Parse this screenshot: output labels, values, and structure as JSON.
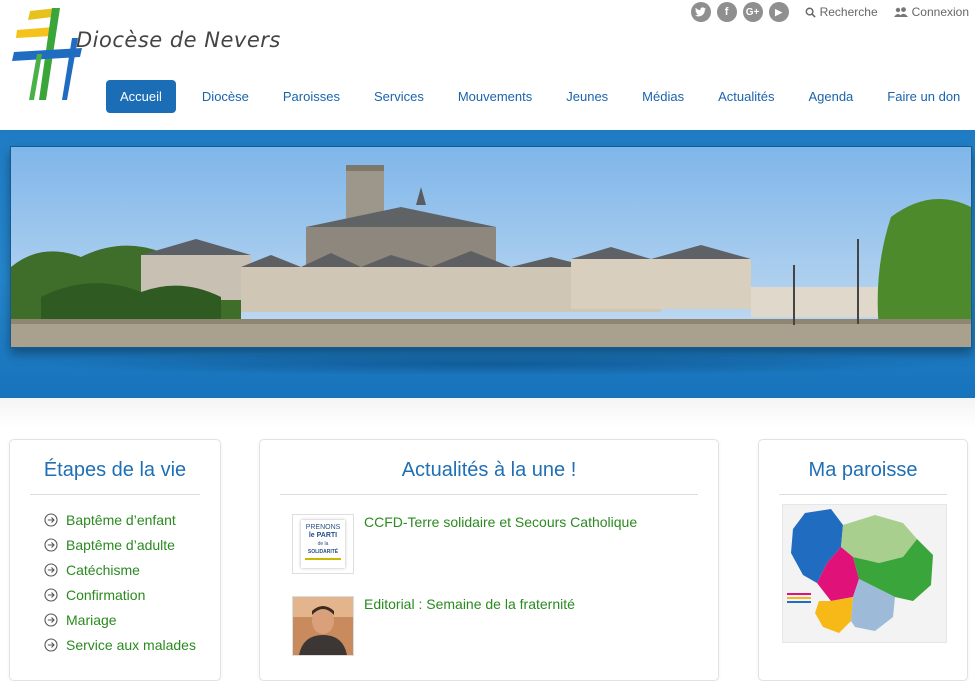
{
  "site": {
    "title": "Diocèse de Nevers"
  },
  "topbar": {
    "social": [
      {
        "name": "twitter-icon",
        "glyph": "t"
      },
      {
        "name": "facebook-icon",
        "glyph": "f"
      },
      {
        "name": "google-plus-icon",
        "glyph": "G+"
      },
      {
        "name": "youtube-icon",
        "glyph": "▶"
      }
    ],
    "search_label": "Recherche",
    "login_label": "Connexion"
  },
  "nav": {
    "items": [
      "Accueil",
      "Diocèse",
      "Paroisses",
      "Services",
      "Mouvements",
      "Jeunes",
      "Médias",
      "Actualités",
      "Agenda",
      "Faire un don"
    ]
  },
  "etapes": {
    "title": "Étapes de la vie",
    "items": [
      "Baptême d’enfant",
      "Baptême d’adulte",
      "Catéchisme",
      "Confirmation",
      "Mariage",
      "Service aux malades"
    ]
  },
  "actualites": {
    "title": "Actualités à la une !",
    "items": [
      {
        "title": "CCFD-Terre solidaire et Secours Catholique",
        "thumb_text": [
          "PRENONS",
          "le PARTI",
          "de la",
          "SOLIDARITÉ"
        ]
      },
      {
        "title": "Editorial : Semaine de la fraternité"
      }
    ]
  },
  "paroisse": {
    "title": "Ma paroisse"
  },
  "colors": {
    "brand_blue": "#1b6db6",
    "link_green": "#2a8a1f",
    "band_blue": "#2586cc"
  }
}
